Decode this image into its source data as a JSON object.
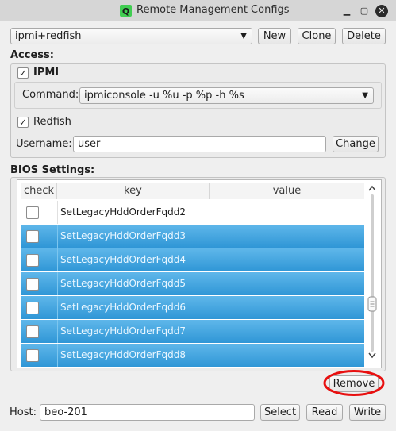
{
  "window": {
    "title": "Remote Management Configs"
  },
  "config": {
    "selected": "ipmi+redfish",
    "new_label": "New",
    "clone_label": "Clone",
    "delete_label": "Delete"
  },
  "access": {
    "heading": "Access:",
    "ipmi_label": "IPMI",
    "command_label": "Command:",
    "command_value": "ipmiconsole -u %u -p %p -h %s",
    "redfish_label": "Redfish",
    "username_label": "Username:",
    "username_value": "user",
    "change_label": "Change"
  },
  "bios": {
    "heading": "BIOS Settings:",
    "columns": [
      "check",
      "key",
      "value"
    ],
    "rows": [
      {
        "key": "SetLegacyHddOrderFqdd2",
        "value": "",
        "selected": false
      },
      {
        "key": "SetLegacyHddOrderFqdd3",
        "value": "",
        "selected": true
      },
      {
        "key": "SetLegacyHddOrderFqdd4",
        "value": "",
        "selected": true
      },
      {
        "key": "SetLegacyHddOrderFqdd5",
        "value": "",
        "selected": true
      },
      {
        "key": "SetLegacyHddOrderFqdd6",
        "value": "",
        "selected": true
      },
      {
        "key": "SetLegacyHddOrderFqdd7",
        "value": "",
        "selected": true
      },
      {
        "key": "SetLegacyHddOrderFqdd8",
        "value": "",
        "selected": true
      }
    ],
    "remove_label": "Remove"
  },
  "footer": {
    "host_label": "Host:",
    "host_value": "beo-201",
    "select_label": "Select",
    "read_label": "Read",
    "write_label": "Write"
  },
  "colors": {
    "selection": "#2f96d6",
    "annotation_circle": "#e81010"
  }
}
